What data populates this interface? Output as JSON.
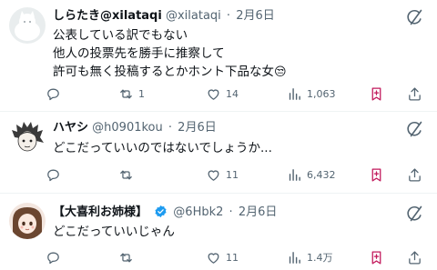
{
  "tweets": [
    {
      "name": "しらたき@xilataqi",
      "handle": "@xilataqi",
      "sep": "·",
      "date": "2月6日",
      "verified": false,
      "lines": [
        "公表している訳でもない",
        "他人の投票先を勝手に推察して",
        "許可も無く投稿するとかホント下品な女"
      ],
      "emoji": "😒",
      "reply_count": "",
      "retweet_count": "1",
      "like_count": "14",
      "view_count": "1,063"
    },
    {
      "name": "ハヤシ",
      "handle": "@h0901kou",
      "sep": "·",
      "date": "2月6日",
      "verified": false,
      "lines": [
        "どこだっていいのではないでしょうか..."
      ],
      "reply_count": "",
      "retweet_count": "",
      "like_count": "11",
      "view_count": "6,432"
    },
    {
      "name": "【大喜利お姉様】",
      "handle": "@6Hbk2",
      "sep": "·",
      "date": "2月6日",
      "verified": true,
      "lines": [
        "どこだっていいじゃん"
      ],
      "reply_count": "",
      "retweet_count": "",
      "like_count": "11",
      "view_count": "1.4万"
    }
  ],
  "colors": {
    "text": "#0f1419",
    "muted": "#536471",
    "verified": "#1d9bf0",
    "bookmark_active": "#c2185b",
    "divider": "#eff3f4"
  }
}
